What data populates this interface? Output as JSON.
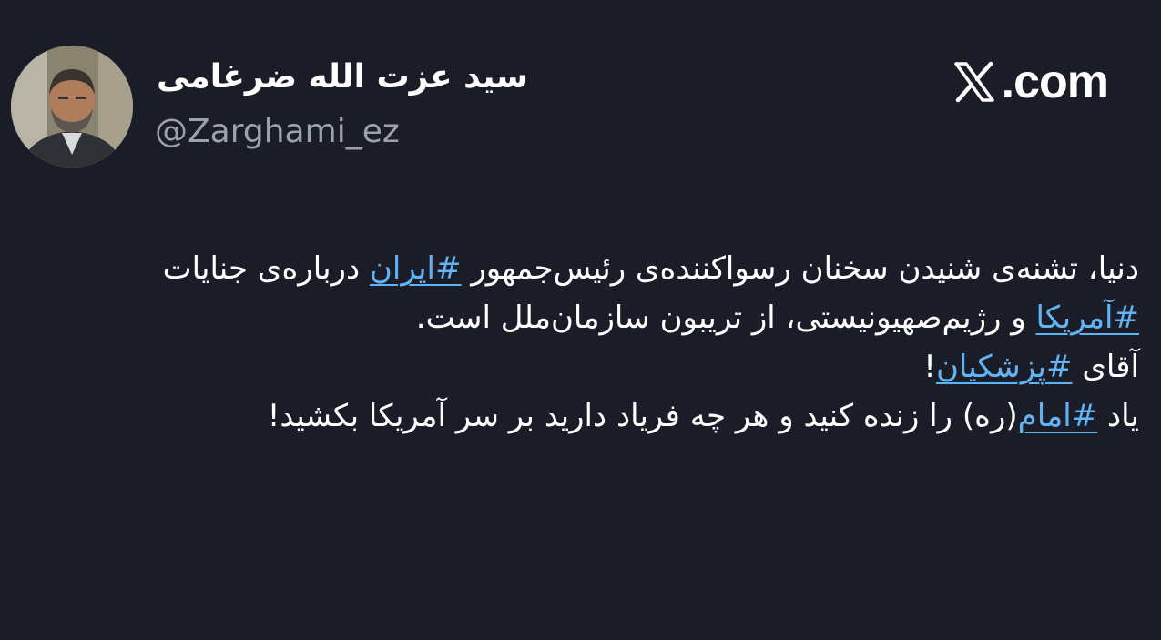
{
  "author": {
    "display_name": "سید عزت الله ضرغامی",
    "handle": "@Zarghami_ez"
  },
  "brand": {
    "icon": "x-logo-icon",
    "text": ".com"
  },
  "tweet": {
    "para1": {
      "t1": "دنیا، تشنه‌ی شنیدن سخنان رسواکننده‌ی رئیس‌جمهور ",
      "h1": "#ایران",
      "t2": " درباره‌ی جنایات ",
      "h2": "#آمریکا",
      "t3": " و رژیم‌صهیونیستی، از تریبون سازمان‌ملل است."
    },
    "para2": {
      "t1": "آقای ",
      "h1": "#پزشکیان",
      "t2": "!"
    },
    "para3": {
      "t1": "یاد ",
      "h1": "#امام",
      "t2": "(ره) را زنده کنید و هر چه فریاد دارید بر سر آمریکا بکشید!"
    }
  },
  "colors": {
    "background": "#1a1d27",
    "hashtag": "#62b3f4",
    "handle": "#9aa3ad"
  }
}
